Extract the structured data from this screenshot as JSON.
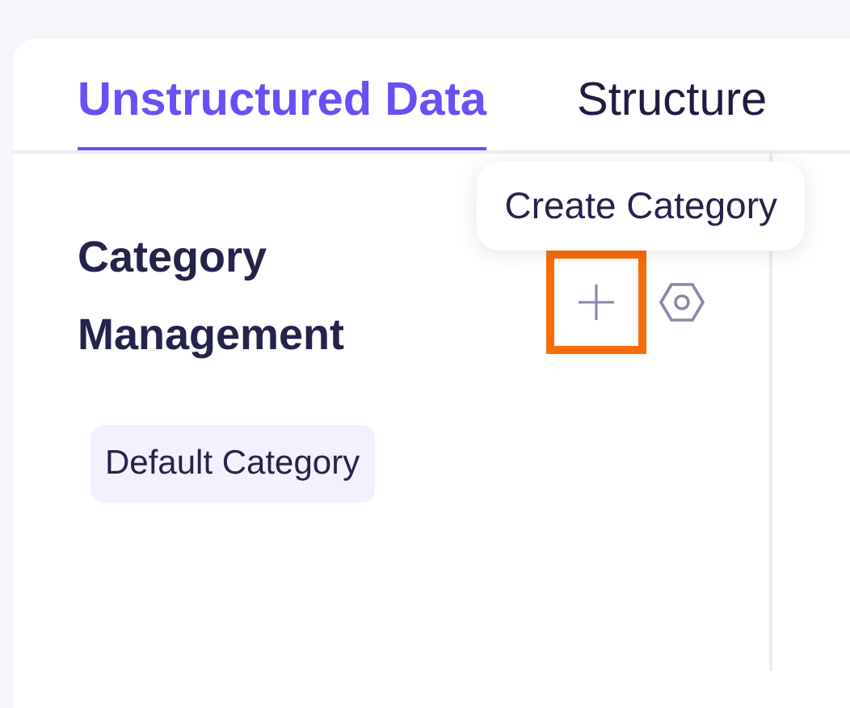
{
  "tabs": [
    {
      "label": "Unstructured Data",
      "selected": true
    },
    {
      "label": "Structure",
      "selected": false
    }
  ],
  "tooltip": {
    "text": "Create Category"
  },
  "panel": {
    "title": "Category Management",
    "highlighted_button": true
  },
  "categories": [
    {
      "label": "Default Category",
      "selected": true
    }
  ]
}
